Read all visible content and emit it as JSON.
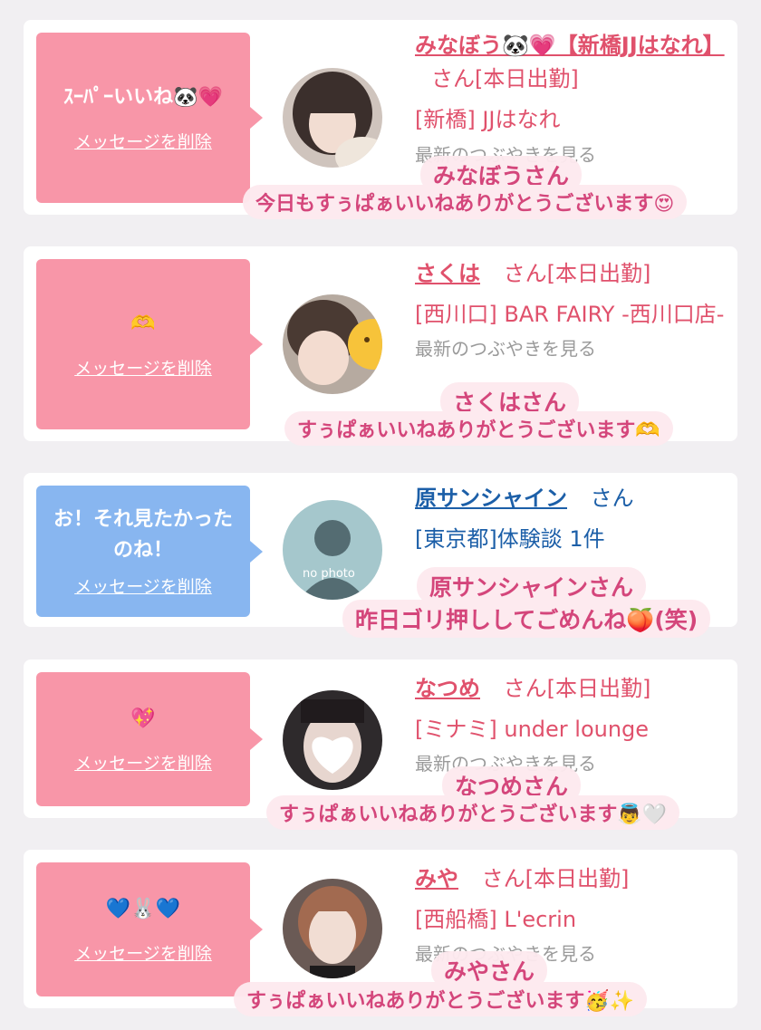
{
  "delete_label": "メッセージを削除",
  "honorific": "さん",
  "cards": [
    {
      "bubble_color": "#f896a8",
      "bubble_text": "ｽｰﾊﾟｰいいね🐼💗",
      "name": "みなぼう🐼💗【新橋JJはなれ】",
      "suffix": "さん[本日出勤]",
      "location": "[新橋] JJはなれ",
      "faint": "最新のつぶやきを見る",
      "caption_name": "みなぼうさん",
      "caption_msg": "今日もすぅぱぁいいねありがとうございます😍"
    },
    {
      "bubble_color": "#f896a8",
      "bubble_text": "🫶",
      "name": "さくは",
      "suffix": "さん[本日出勤]",
      "location": "[西川口] BAR FAIRY -西川口店-",
      "faint": "最新のつぶやきを見る",
      "caption_name": "さくはさん",
      "caption_msg": "すぅぱぁいいねありがとうございます🫶"
    },
    {
      "bubble_color": "#88b6f0",
      "bubble_text": "お！それ見たかったのね！",
      "name": "原サンシャイン",
      "suffix": "さん",
      "location": "[東京都]体験談 1件",
      "avatar_text": "no photo",
      "caption_name": "原サンシャインさん",
      "caption_msg": "昨日ゴリ押ししてごめんね🍑(笑)"
    },
    {
      "bubble_color": "#f896a8",
      "bubble_text": "💖",
      "name": "なつめ",
      "suffix": "さん[本日出勤]",
      "location": "[ミナミ] under lounge",
      "faint": "最新のつぶやきを見る",
      "caption_name": "なつめさん",
      "caption_msg": "すぅぱぁいいねありがとうございます👼🤍"
    },
    {
      "bubble_color": "#f896a8",
      "bubble_text": "💙🐰💙",
      "name": "みや",
      "suffix": "さん[本日出勤]",
      "location": "[西船橋] L'ecrin",
      "faint": "最新のつぶやきを見る",
      "caption_name": "みやさん",
      "caption_msg": "すぅぱぁいいねありがとうございます🥳✨"
    }
  ]
}
